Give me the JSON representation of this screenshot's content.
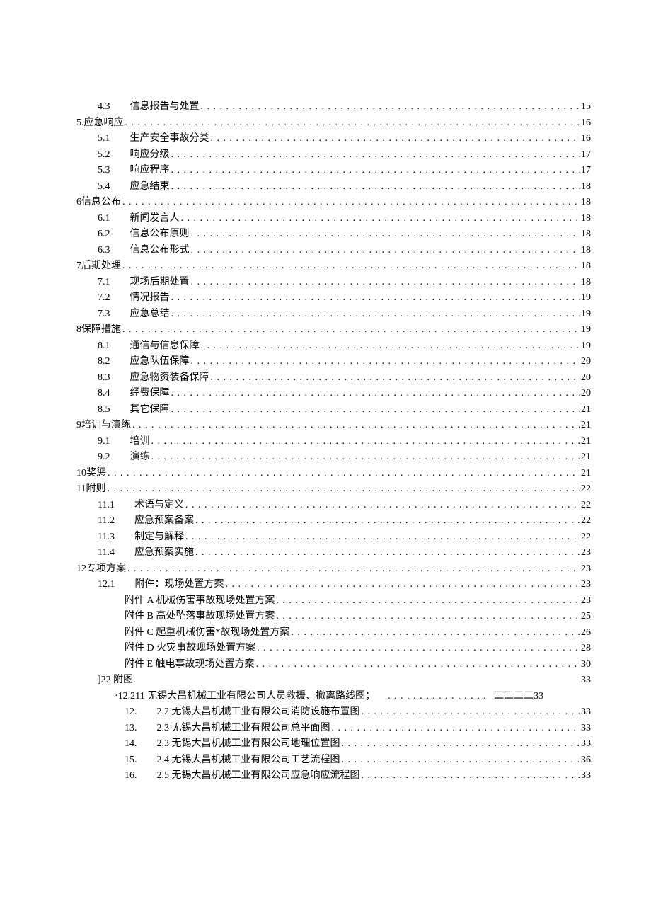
{
  "toc": {
    "entries": [
      {
        "level": 1,
        "num": "4.3",
        "title": "信息报告与处置",
        "page": "15",
        "hasNumSpace": true
      },
      {
        "level": 0,
        "num": "5.",
        "title": "应急响应",
        "page": "16",
        "hasNumSpace": false
      },
      {
        "level": 1,
        "num": "5.1",
        "title": "生产安全事故分类",
        "page": "16",
        "hasNumSpace": true
      },
      {
        "level": 1,
        "num": "5.2",
        "title": "响应分级",
        "page": "17",
        "hasNumSpace": true
      },
      {
        "level": 1,
        "num": "5.3",
        "title": "响应程序",
        "page": "17",
        "hasNumSpace": true
      },
      {
        "level": 1,
        "num": "5.4",
        "title": "应急结束",
        "page": "18",
        "hasNumSpace": true
      },
      {
        "level": 0,
        "num": "6 ",
        "title": "信息公布",
        "page": "18",
        "hasNumSpace": false
      },
      {
        "level": 1,
        "num": "6.1",
        "title": "新闻发言人",
        "page": "18",
        "hasNumSpace": true
      },
      {
        "level": 1,
        "num": "6.2",
        "title": "信息公布原则",
        "page": "18",
        "hasNumSpace": true
      },
      {
        "level": 1,
        "num": "6.3",
        "title": "信息公布形式",
        "page": "18",
        "hasNumSpace": true
      },
      {
        "level": 0,
        "num": "7 ",
        "title": "后期处理",
        "page": "18",
        "hasNumSpace": false
      },
      {
        "level": 1,
        "num": "7.1",
        "title": "现场后期处置",
        "page": "18",
        "hasNumSpace": true
      },
      {
        "level": 1,
        "num": "7.2",
        "title": "情况报告",
        "page": "19",
        "hasNumSpace": true
      },
      {
        "level": 1,
        "num": "7.3",
        "title": "应急总结",
        "page": "19",
        "hasNumSpace": true
      },
      {
        "level": 0,
        "num": "8 ",
        "title": "保障措施",
        "page": "19",
        "hasNumSpace": false
      },
      {
        "level": 1,
        "num": "8.1",
        "title": "通信与信息保障",
        "page": "19",
        "hasNumSpace": true
      },
      {
        "level": 1,
        "num": "8.2",
        "title": "应急队伍保障",
        "page": "20",
        "hasNumSpace": true
      },
      {
        "level": 1,
        "num": "8.3",
        "title": "应急物资装备保障",
        "page": "20",
        "hasNumSpace": true
      },
      {
        "level": 1,
        "num": "8.4",
        "title": "经费保障",
        "page": "20",
        "hasNumSpace": true
      },
      {
        "level": 1,
        "num": "8.5",
        "title": "其它保障",
        "page": "21",
        "hasNumSpace": true
      },
      {
        "level": 0,
        "num": "9 ",
        "title": "培训与演练",
        "page": "21",
        "hasNumSpace": false
      },
      {
        "level": 1,
        "num": "9.1",
        "title": "培训",
        "page": "21",
        "hasNumSpace": true
      },
      {
        "level": 1,
        "num": "9.2",
        "title": "演练",
        "page": "21",
        "hasNumSpace": true
      },
      {
        "level": 0,
        "num": "10 ",
        "title": "奖惩",
        "page": "21",
        "hasNumSpace": false
      },
      {
        "level": 0,
        "num": "11 ",
        "title": "附则",
        "page": "22",
        "hasNumSpace": false
      },
      {
        "level": 1,
        "num": "11.1",
        "title": "术语与定义",
        "page": "22",
        "hasNumSpace": true
      },
      {
        "level": 1,
        "num": "11.2",
        "title": "应急预案备案",
        "page": "22",
        "hasNumSpace": true
      },
      {
        "level": 1,
        "num": "11.3",
        "title": "制定与解释",
        "page": "22",
        "hasNumSpace": true
      },
      {
        "level": 1,
        "num": "11.4",
        "title": "应急预案实施",
        "page": "23",
        "hasNumSpace": true
      },
      {
        "level": 0,
        "num": "12 ",
        "title": "专项方案",
        "page": "23",
        "hasNumSpace": false
      },
      {
        "level": 1,
        "num": "12.1",
        "title": "附件：现场处置方案",
        "page": "23",
        "hasNumSpace": true
      },
      {
        "level": 2,
        "num": "",
        "title": "附件 A 机械伤害事故现场处置方案 ",
        "page": "23",
        "hasNumSpace": false
      },
      {
        "level": 2,
        "num": "",
        "title": "附件 B 高处坠落事故现场处置方案 ",
        "page": "25",
        "hasNumSpace": false
      },
      {
        "level": 2,
        "num": "",
        "title": "附件 C 起重机械伤害*故现场处置方案 ",
        "page": "26",
        "hasNumSpace": false
      },
      {
        "level": 2,
        "num": "",
        "title": "附件 D 火灾事故现场处置方案 ",
        "page": "28",
        "hasNumSpace": false
      },
      {
        "level": 2,
        "num": "",
        "title": "附件 E 触电事故现场处置方案 ",
        "page": "30",
        "hasNumSpace": false
      },
      {
        "level": 1,
        "num": "",
        "title": "]22 附图.",
        "page": "33",
        "hasNumSpace": false,
        "noDots": true
      },
      {
        "level": 2,
        "num": "",
        "title": "·12.211 无锡大昌机械工业有限公司人员救援、撤离路线图；",
        "page": "33",
        "hasNumSpace": false,
        "pagePrefix": "二二二二 ",
        "shortDots": true,
        "padLeft": -14
      },
      {
        "level": 2,
        "num": "12.",
        "title": "2.2 无锡大昌机械工业有限公司消防设施布置图 ",
        "page": "33",
        "hasNumSpace": true
      },
      {
        "level": 2,
        "num": "13.",
        "title": "2.3 无锡大昌机械工业有限公司总平面图 ",
        "page": "33",
        "hasNumSpace": true
      },
      {
        "level": 2,
        "num": "14.",
        "title": "2.3 无锡大昌机械工业有限公司地理位置图 ",
        "page": "33",
        "hasNumSpace": true
      },
      {
        "level": 2,
        "num": "15.",
        "title": "2.4 无锡大昌机械工业有限公司工艺流程图 ",
        "page": "36",
        "hasNumSpace": true
      },
      {
        "level": 2,
        "num": "16.",
        "title": "2.5 无锡大昌机械工业有限公司应急响应流程图 ",
        "page": "33",
        "hasNumSpace": true
      }
    ]
  }
}
